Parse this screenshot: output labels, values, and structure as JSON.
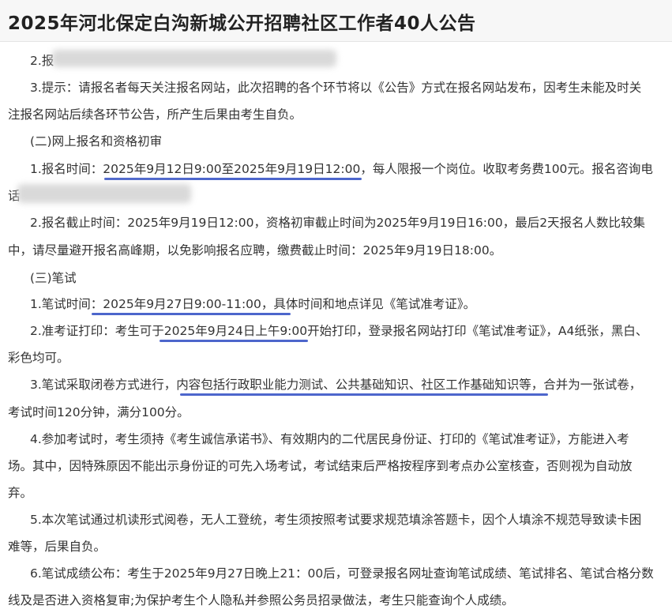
{
  "page_title": "2025年河北保定白沟新城公开招聘社区工作者40人公告",
  "lines": {
    "l1": "2.报",
    "l2": "3.提示：请报名者每天关注报名网站，此次招聘的各个环节将以《公告》方式在报名网站发布，因考生未能及时关",
    "l3": "注报名网站后续各环节公告，所产生后果由考生自负。",
    "l4": "(二)网上报名和资格初审",
    "l5": "1.报名时间：2025年9月12日9:00至2025年9月19日12:00，每人限报一个岗位。收取考务费100元。报名咨询电",
    "l6": "话",
    "l7": "2.报名截止时间：2025年9月19日12:00，资格初审截止时间为2025年9月19日16:00，最后2天报名人数比较集",
    "l8": "中，请尽量避开报名高峰期，以免影响报名应聘，缴费截止时间：2025年9月19日18:00。",
    "l9": "(三)笔试",
    "l10": "1.笔试时间：2025年9月27日9:00-11:00，具体时间和地点详见《笔试准考证》。",
    "l11": "2.准考证打印：考生可于2025年9月24日上午9:00开始打印，登录报名网站打印《笔试准考证》，A4纸张，黑白、",
    "l12": "彩色均可。",
    "l13": "3.笔试采取闭卷方式进行，内容包括行政职业能力测试、公共基础知识、社区工作基础知识等，合并为一张试卷，",
    "l14": "考试时间120分钟，满分100分。",
    "l15": "4.参加考试时，考生须持《考生诚信承诺书》、有效期内的二代居民身份证、打印的《笔试准考证》，方能进入考",
    "l16": "场。其中，因特殊原因不能出示身份证的可先入场考试，考试结束后严格按程序到考点办公室核查，否则视为自动放",
    "l17": "弃。",
    "l18": "5.本次笔试通过机读形式阅卷，无人工登统，考生须按照考试要求规范填涂答题卡，因个人填涂不规范导致读卡困",
    "l19": "难等，后果自负。",
    "l20": "6.笔试成绩公布：考生于2025年9月27日晚上21：00后，可登录报名网址查询笔试成绩、笔试排名、笔试合格分数",
    "l21": "线及是否进入资格复审;为保护考生个人隐私并参照公务员招录做法，考生只能查询个人成绩。"
  },
  "colors": {
    "underline": "#3a55c7",
    "text": "#333333",
    "header_bg": "#f7f7f7"
  }
}
